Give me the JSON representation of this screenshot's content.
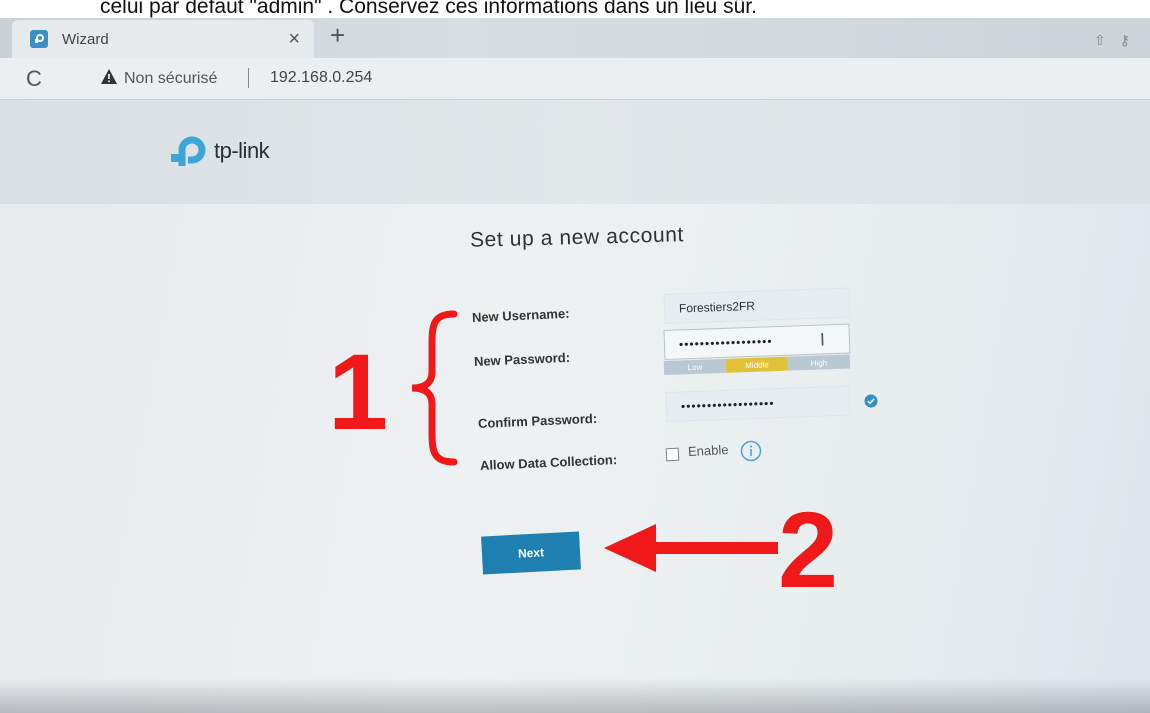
{
  "caption": "celui par défaut \"admin\" . Conservez ces informations dans un lieu sûr.",
  "browser": {
    "tab_title": "Wizard",
    "tab_close": "×",
    "new_tab": "+",
    "reload": "C",
    "not_secure": "Non sécurisé",
    "url": "192.168.0.254"
  },
  "header": {
    "brand": "tp-link"
  },
  "form": {
    "title": "Set up a new account",
    "username_label": "New Username:",
    "username_value": "Forestiers2FR",
    "password_label": "New Password:",
    "password_mask": "••••••••••••••••••",
    "strength": [
      "Low",
      "Middle",
      "High"
    ],
    "confirm_label": "Confirm Password:",
    "confirm_mask": "••••••••••••••••••",
    "data_collection_label": "Allow Data Collection:",
    "enable_label": "Enable",
    "next": "Next"
  },
  "annotations": {
    "marker_1": "1",
    "marker_2": "2"
  },
  "colors": {
    "accent": "#1f7fb0",
    "annotation_red": "#f01818",
    "strength_active": "#e0c23a",
    "strength_inactive": "#b9c8d3"
  }
}
